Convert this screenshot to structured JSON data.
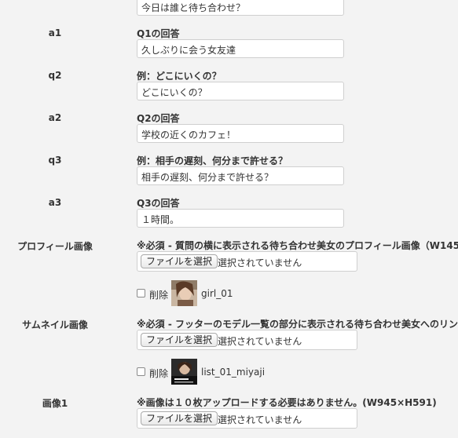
{
  "rows": {
    "q1_input": "今日は誰と待ち合わせ？",
    "a1": {
      "label": "a1",
      "title": "Q1の回答",
      "value": "久しぶりに会う女友達"
    },
    "q2": {
      "label": "q2",
      "title": "例：どこにいくの？",
      "value": "どこにいくの？"
    },
    "a2": {
      "label": "a2",
      "title": "Q2の回答",
      "value": "学校の近くのカフェ！"
    },
    "q3": {
      "label": "q3",
      "title": "例：相手の遅刻、何分まで許せる？",
      "value": "相手の遅刻、何分まで許せる？"
    },
    "a3": {
      "label": "a3",
      "title": "Q3の回答",
      "value": "１時間。"
    }
  },
  "profile_image": {
    "label": "プロフィール画像",
    "note": "※必須 - 質問の横に表示される待ち合わせ美女のプロフィール画像（W145",
    "button": "ファイルを選択",
    "status": "選択されていません",
    "delete_label": "削除",
    "filename": "girl_01"
  },
  "thumbnail_image": {
    "label": "サムネイル画像",
    "note": "※必須 - フッターのモデル一覧の部分に表示される待ち合わせ美女へのリン",
    "button": "ファイルを選択",
    "status": "選択されていません",
    "delete_label": "削除",
    "filename": "list_01_miyaji"
  },
  "image1": {
    "label": "画像1",
    "note": "※画像は１０枚アップロードする必要はありません。(W945×H591)",
    "button": "ファイルを選択",
    "status": "選択されていません"
  },
  "colors": {
    "background": "#f3f3f3",
    "input_border": "#cfcfcf"
  },
  "icons": {
    "checkbox": "checkbox-unchecked",
    "thumb1": "portrait-photo",
    "thumb2": "portrait-photo-card"
  }
}
